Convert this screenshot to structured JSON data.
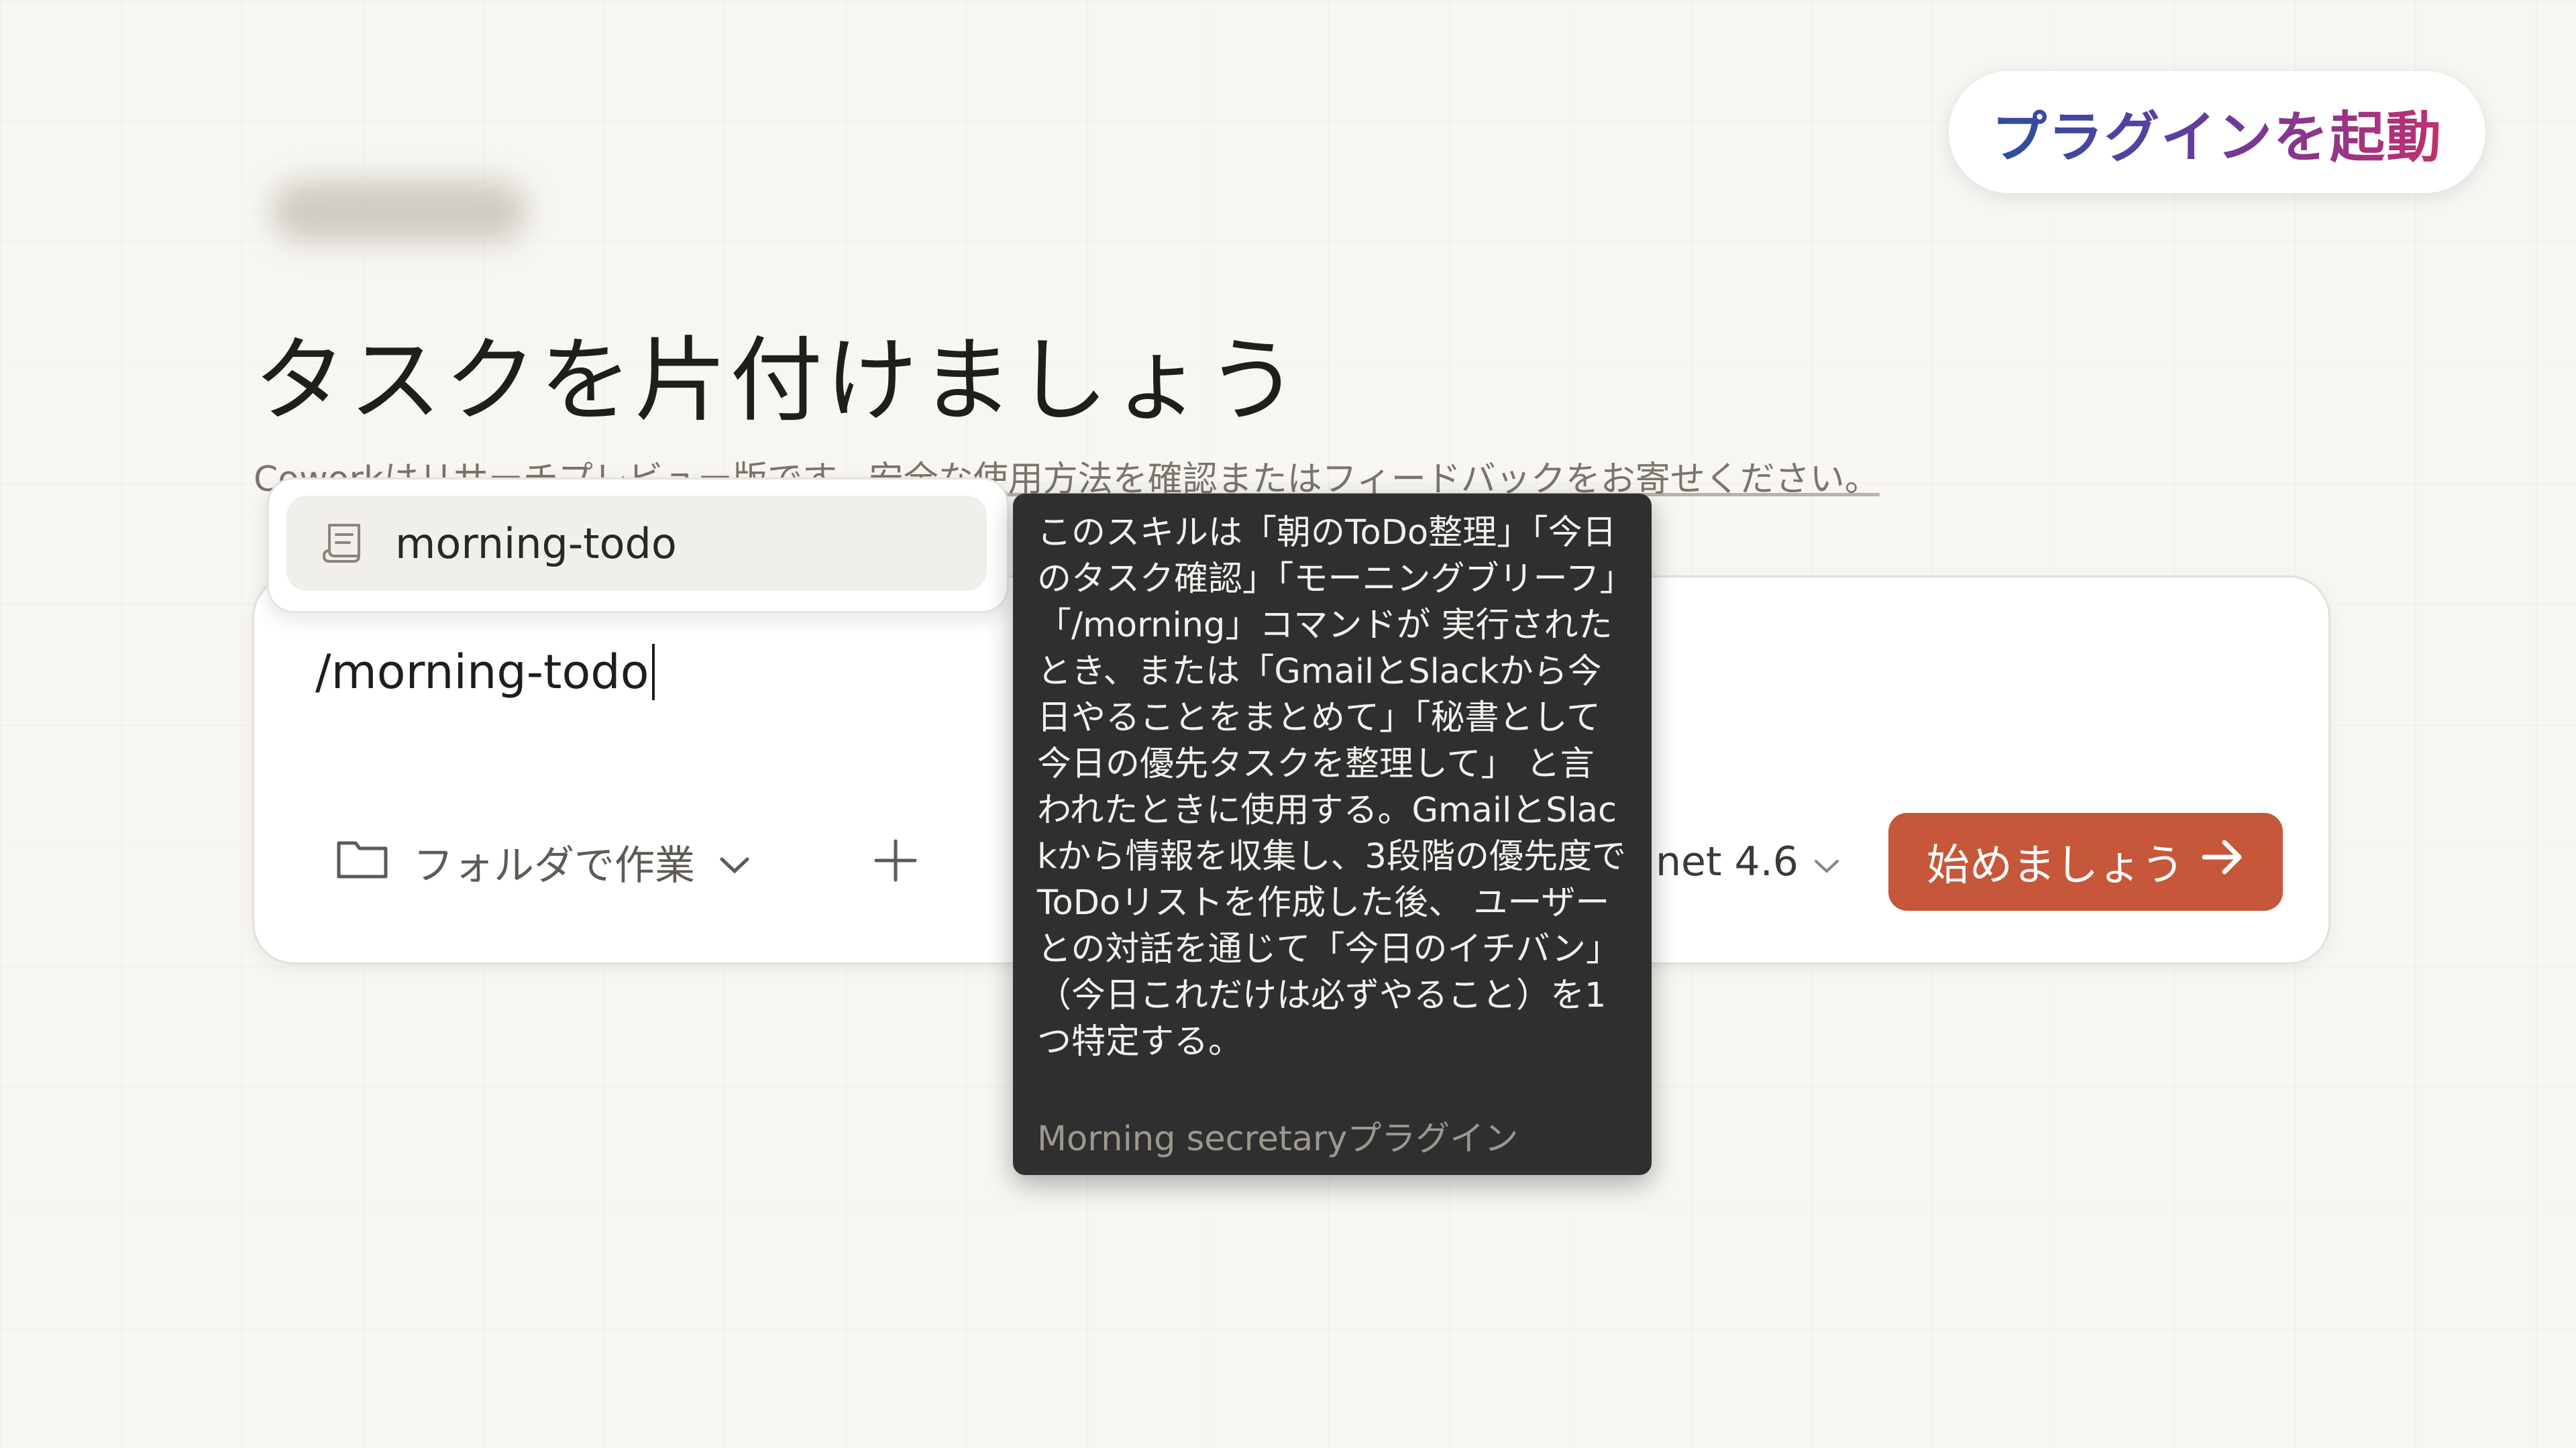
{
  "badge": {
    "label": "プラグインを起動"
  },
  "main": {
    "title": "タスクを片付けましょう",
    "notice_prefix": "Coworkはリサーチプレビュー版です。",
    "notice_link": "安全な使用方法を確認またはフィードバックをお寄せください。"
  },
  "composer": {
    "input_value": "/morning-todo",
    "folder_label": "フォルダで作業",
    "model_label": "net 4.6",
    "start_label": "始めましょう"
  },
  "suggestion": {
    "label": "morning-todo"
  },
  "tooltip": {
    "description": "このスキルは「朝のToDo整理」「今日のタスク確認」「モーニングブリーフ」「/morning」コマンドが 実行されたとき、または「GmailとSlackから今日やることをまとめて」「秘書として今日の優先タスクを整理して」 と言われたときに使用する。GmailとSlackから情報を収集し、3段階の優先度でToDoリストを作成した後、 ユーザーとの対話を通じて「今日のイチバン」（今日これだけは必ずやること）を1つ特定する。",
    "source": "Morning secretaryプラグイン"
  },
  "colors": {
    "accent": "#c6573a",
    "background": "#f7f6f2",
    "tooltip_bg": "#2f2f2f"
  },
  "icons": [
    "folder-icon",
    "chevron-down-icon",
    "plus-icon",
    "arrow-right-icon",
    "scroll-icon"
  ]
}
